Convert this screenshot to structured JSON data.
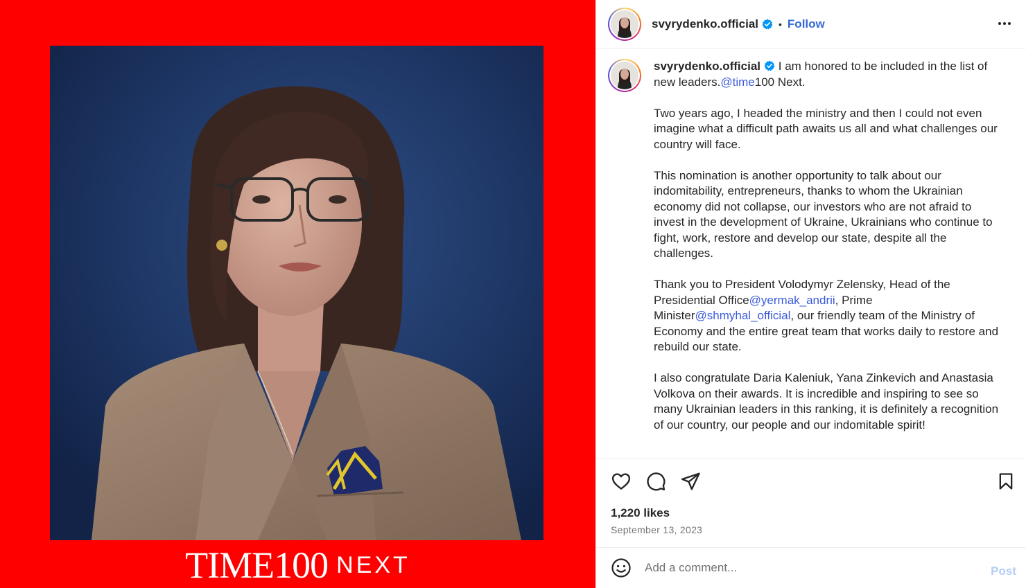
{
  "media": {
    "logo_text": "TIME100",
    "logo_suffix": "NEXT",
    "background_color": "#ff0000"
  },
  "header": {
    "username": "svyrydenko.official",
    "separator": "•",
    "follow_label": "Follow",
    "verified": true,
    "more_icon": "more-horizontal-icon"
  },
  "caption": {
    "username": "svyrydenko.official",
    "intro": "I am honored to be included in the list of new leaders.",
    "intro_mention": "@time",
    "intro_tail": "100 Next.",
    "para2": "Two years ago, I headed the ministry and then I could not even imagine what a difficult path awaits us all and what challenges our country will face.",
    "para3": "This nomination is another opportunity to talk about our indomitability, entrepreneurs, thanks to whom the Ukrainian economy did not collapse, our investors who are not afraid to invest in the development of Ukraine, Ukrainians who continue to fight, work, restore and develop our state, despite all the challenges.",
    "para4_a": "Thank you to President Volodymyr Zelensky, Head of the Presidential Office",
    "para4_mention1": "@yermak_andrii",
    "para4_b": ", Prime Minister",
    "para4_mention2": "@shmyhal_official",
    "para4_c": ", our friendly team of the Ministry of Economy and the entire great team that works daily to restore and rebuild our state.",
    "para5": "I also congratulate Daria Kaleniuk, Yana Zinkevich and Anastasia Volkova on their awards. It is incredible and inspiring to see so many Ukrainian leaders in this ranking, it is definitely a recognition of our country, our people and our indomitable spirit!"
  },
  "actions": {
    "like_icon": "heart-icon",
    "comment_icon": "comment-icon",
    "share_icon": "share-icon",
    "save_icon": "bookmark-icon",
    "likes": "1,220 likes",
    "date": "September 13, 2023"
  },
  "comment": {
    "placeholder": "Add a comment...",
    "post_label": "Post",
    "emoji_icon": "emoji-icon"
  },
  "colors": {
    "accent_link": "#3468d6",
    "verified_badge": "#0095f6",
    "post_disabled": "#b3cdf5"
  }
}
